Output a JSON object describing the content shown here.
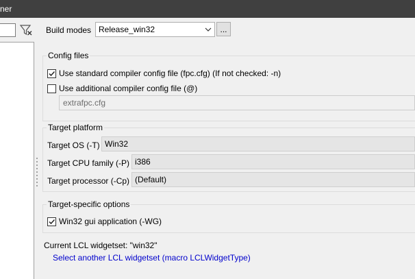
{
  "titlebar": {
    "title": "ner"
  },
  "build_modes": {
    "label": "Build modes",
    "value": "Release_win32",
    "more_button": "..."
  },
  "config_files": {
    "title": "Config files",
    "use_standard": {
      "label": "Use standard compiler config file (fpc.cfg) (If not checked: -n)",
      "checked": true
    },
    "use_additional": {
      "label": "Use additional compiler config file (@)",
      "checked": false
    },
    "extra_file_value": "extrafpc.cfg"
  },
  "target_platform": {
    "title": "Target platform",
    "os": {
      "label": "Target OS (-T)",
      "value": "Win32"
    },
    "cpu": {
      "label": "Target CPU family (-P)",
      "value": "i386"
    },
    "processor": {
      "label": "Target processor (-Cp)",
      "value": "(Default)"
    }
  },
  "target_specific": {
    "title": "Target-specific options",
    "win32_gui": {
      "label": "Win32 gui application (-WG)",
      "checked": true
    }
  },
  "lcl": {
    "current_label": "Current LCL widgetset: \"win32\"",
    "select_link": "Select another LCL widgetset (macro LCLWidgetType)"
  }
}
